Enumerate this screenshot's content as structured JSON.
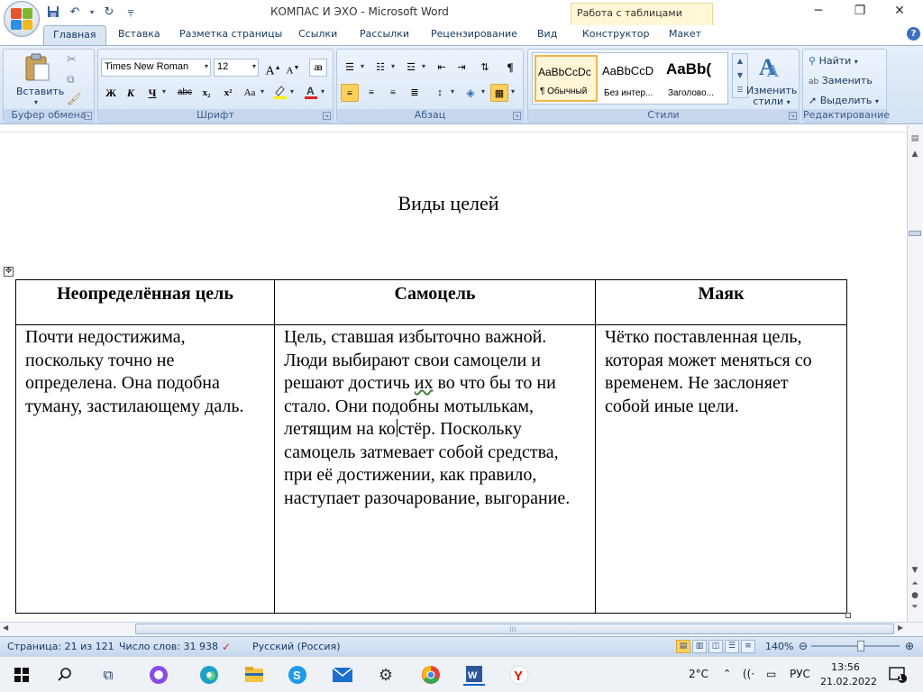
{
  "window": {
    "title": "КОМПАС И ЭХО - Microsoft Word",
    "context_tab_title": "Работа с таблицами"
  },
  "tabs": [
    "Главная",
    "Вставка",
    "Разметка страницы",
    "Ссылки",
    "Рассылки",
    "Рецензирование",
    "Вид",
    "Конструктор",
    "Макет"
  ],
  "ribbon": {
    "clipboard": {
      "paste_label": "Вставить",
      "group_label": "Буфер обмена"
    },
    "font": {
      "name": "Times New Roman",
      "size": "12",
      "group_label": "Шрифт",
      "bold": "Ж",
      "italic": "К",
      "underline": "Ч",
      "strike": "abc",
      "sub": "x₂",
      "sup": "x²",
      "case": "Aa",
      "grow": "A",
      "shrink": "A"
    },
    "paragraph": {
      "group_label": "Абзац"
    },
    "styles": {
      "group_label": "Стили",
      "change_label_1": "Изменить",
      "change_label_2": "стили",
      "items": [
        {
          "sample": "AaBbCcDc",
          "name": "¶ Обычный"
        },
        {
          "sample": "AaBbCcD",
          "name": "Без интер..."
        },
        {
          "sample": "AaBb(",
          "name": "Заголово..."
        }
      ]
    },
    "editing": {
      "group_label": "Редактирование",
      "find": "Найти",
      "replace": "Заменить",
      "select": "Выделить"
    }
  },
  "document": {
    "title": "Виды целей",
    "table": {
      "headers": [
        "Неопределённая цель",
        "Самоцель",
        "Маяк"
      ],
      "cells": {
        "c1": "Почти недостижима, поскольку точно не определена. Она подобна туману, застилающему даль.",
        "c2_a": "Цель, ставшая избыточно важной. Люди выбирают свои самоцели и решают достичь ",
        "c2_wavy": "их",
        "c2_b": " во что бы то ни стало. Они подобны мотылькам, летящим на ко",
        "c2_c": "стёр. Поскольку самоцель затмевает собой средства, при её достижении, как правило, наступает разочарование, выгорание.",
        "c3": "Чётко поставленная цель, которая может меняться со временем. Не заслоняет собой иные цели."
      }
    }
  },
  "statusbar": {
    "page": "Страница: 21 из 121",
    "words": "Число слов: 31 938",
    "language": "Русский (Россия)",
    "zoom": "140%"
  },
  "taskbar": {
    "temperature": "2°C",
    "lang": "РУС",
    "time": "13:56",
    "date": "21.02.2022",
    "notifications": "1"
  }
}
